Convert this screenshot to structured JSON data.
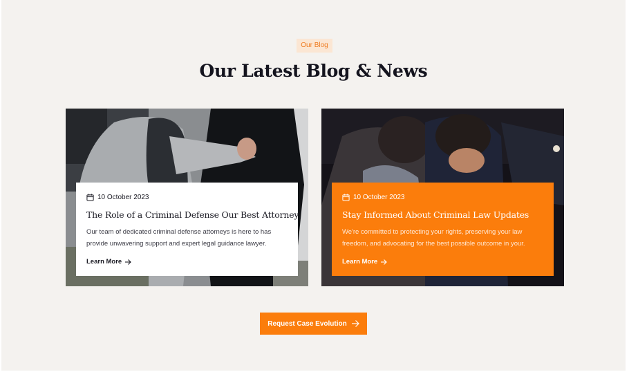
{
  "blog": {
    "tag": "Our Blog",
    "heading": "Our Latest Blog & News",
    "posts": [
      {
        "date": "10 October 2023",
        "title": "The Role of a Criminal Defense Our Best Attorney",
        "excerpt": "Our team of dedicated criminal defense attorneys is here to has provide unwavering support and expert legal guidance lawyer.",
        "link_label": "Learn More"
      },
      {
        "date": "10 October 2023",
        "title": "Stay Informed About Criminal Law Updates",
        "excerpt": "We're committed to protecting your rights, preserving your law freedom, and advocating for the best possible outcome in your.",
        "link_label": "Learn More"
      }
    ],
    "cta_label": "Request Case Evolution"
  },
  "colors": {
    "accent": "#fb7d0c",
    "tag_bg": "#fbe6d3",
    "section_bg": "#f4f2ef",
    "text_dark": "#14141e"
  },
  "icons": {
    "date": "calendar-icon",
    "link": "arrow-right-icon"
  }
}
